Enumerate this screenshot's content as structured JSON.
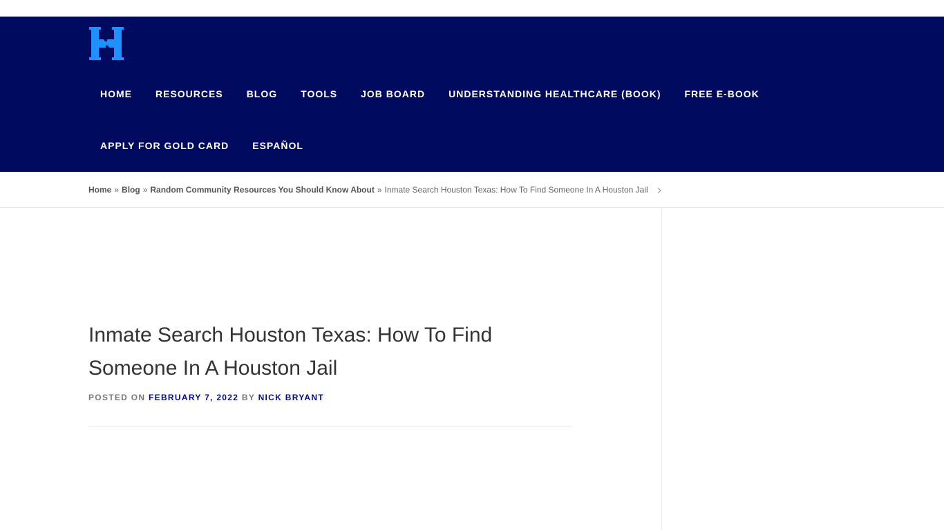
{
  "brand": {
    "logo_icon": "hands-h-logo-icon",
    "colors": {
      "header_bg": "#000a5e",
      "logo_blue": "#1e90ff",
      "link": "#000a8e"
    }
  },
  "nav": {
    "row1": [
      "HOME",
      "RESOURCES",
      "BLOG",
      "TOOLS",
      "JOB BOARD",
      "UNDERSTANDING HEALTHCARE (BOOK)",
      "FREE E-BOOK"
    ],
    "row2": [
      "APPLY FOR GOLD CARD",
      "ESPAÑOL"
    ]
  },
  "breadcrumb": {
    "home": "Home",
    "blog": "Blog",
    "category": "Random Community Resources You Should Know About",
    "current": "Inmate Search Houston Texas: How To Find Someone In A Houston Jail",
    "separator": "»"
  },
  "post": {
    "title": "Inmate Search Houston Texas: How To Find Someone In A Houston Jail",
    "posted_on_label": "POSTED ON",
    "date": "FEBRUARY 7, 2022",
    "by_label": "BY",
    "author": "NICK BRYANT"
  }
}
